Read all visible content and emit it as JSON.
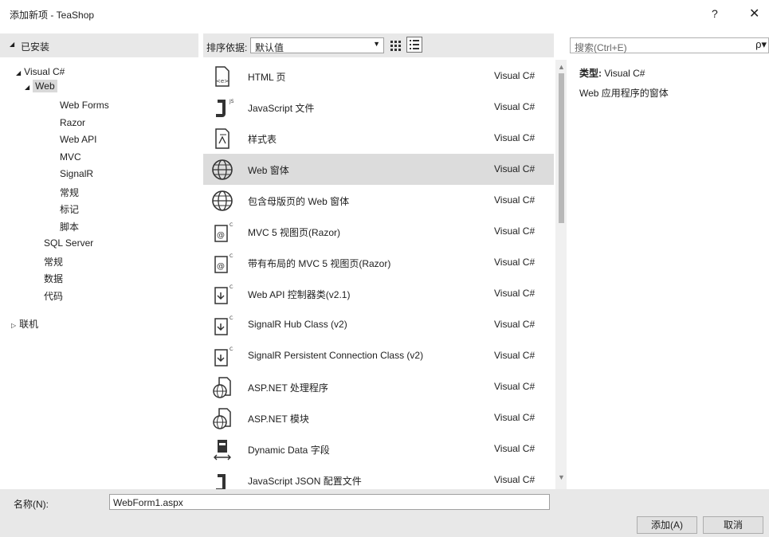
{
  "window": {
    "title": "添加新项 - TeaShop",
    "help": "?",
    "close": "✕"
  },
  "left": {
    "header": "已安装",
    "header_arrow": "◢",
    "tree": {
      "visual_csharp": "Visual C#",
      "web": "Web",
      "web_children": [
        "Web Forms",
        "Razor",
        "Web API",
        "MVC",
        "SignalR",
        "常规",
        "标记",
        "脚本"
      ],
      "siblings": [
        "SQL Server",
        "常规",
        "数据",
        "代码"
      ],
      "online": "联机",
      "expanded_glyph": "◢",
      "collapsed_glyph": "▷"
    }
  },
  "toolbar": {
    "sort_label": "排序依据:",
    "sort_value": "默认值",
    "sort_arrow": "▼"
  },
  "templates": [
    {
      "name": "HTML 页",
      "lang": "Visual C#",
      "icon": "html-page-icon"
    },
    {
      "name": "JavaScript 文件",
      "lang": "Visual C#",
      "icon": "javascript-file-icon"
    },
    {
      "name": "样式表",
      "lang": "Visual C#",
      "icon": "stylesheet-icon"
    },
    {
      "name": "Web 窗体",
      "lang": "Visual C#",
      "icon": "globe-icon"
    },
    {
      "name": "包含母版页的 Web 窗体",
      "lang": "Visual C#",
      "icon": "globe-icon"
    },
    {
      "name": "MVC 5 视图页(Razor)",
      "lang": "Visual C#",
      "icon": "razor-view-icon"
    },
    {
      "name": "带有布局的 MVC 5 视图页(Razor)",
      "lang": "Visual C#",
      "icon": "razor-view-icon"
    },
    {
      "name": "Web API 控制器类(v2.1)",
      "lang": "Visual C#",
      "icon": "controller-class-icon"
    },
    {
      "name": "SignalR Hub Class (v2)",
      "lang": "Visual C#",
      "icon": "controller-class-icon"
    },
    {
      "name": "SignalR Persistent Connection Class (v2)",
      "lang": "Visual C#",
      "icon": "controller-class-icon"
    },
    {
      "name": "ASP.NET 处理程序",
      "lang": "Visual C#",
      "icon": "globe-page-icon"
    },
    {
      "name": "ASP.NET 模块",
      "lang": "Visual C#",
      "icon": "globe-page-icon"
    },
    {
      "name": "Dynamic Data 字段",
      "lang": "Visual C#",
      "icon": "dynamic-data-icon"
    },
    {
      "name": "JavaScript JSON 配置文件",
      "lang": "Visual C#",
      "icon": "json-config-icon"
    }
  ],
  "selected_index": 3,
  "search": {
    "placeholder": "搜索(Ctrl+E)",
    "icon": "ρ▾"
  },
  "details": {
    "type_label": "类型:",
    "type_value": "Visual C#",
    "description": "Web 应用程序的窗体"
  },
  "footer": {
    "name_label": "名称(N):",
    "name_value": "WebForm1.aspx",
    "add_button": "添加(A)",
    "cancel_button": "取消"
  }
}
